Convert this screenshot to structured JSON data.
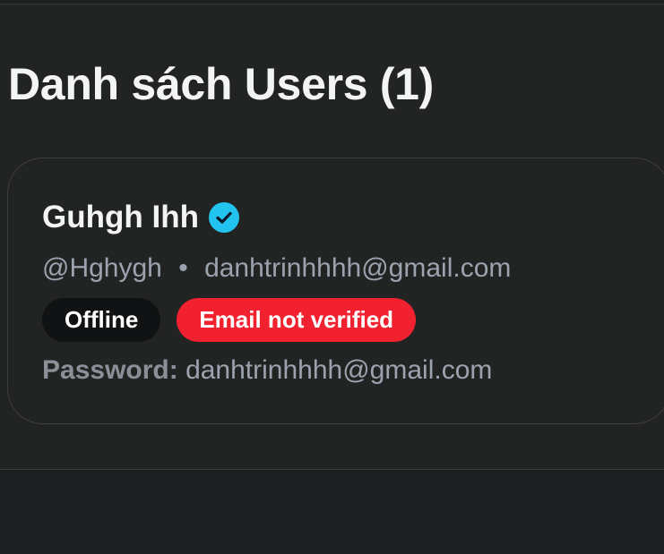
{
  "page": {
    "title": "Danh sách Users (1)"
  },
  "users": [
    {
      "name": "Guhgh Ihh",
      "verified_icon": "check-circle-icon",
      "username": "@Hghygh",
      "separator": "•",
      "email": "danhtrinhhhh@gmail.com",
      "badges": {
        "status": "Offline",
        "email_status": "Email not verified"
      },
      "password_label": "Password:",
      "password_value": "danhtrinhhhh@gmail.com"
    }
  ],
  "colors": {
    "background": "#1e1f21",
    "panel": "#222323",
    "verified_badge": "#22c4ef",
    "offline_badge": "#101214",
    "email_not_verified_badge": "#f2212f",
    "muted_text": "#9ca3af"
  }
}
